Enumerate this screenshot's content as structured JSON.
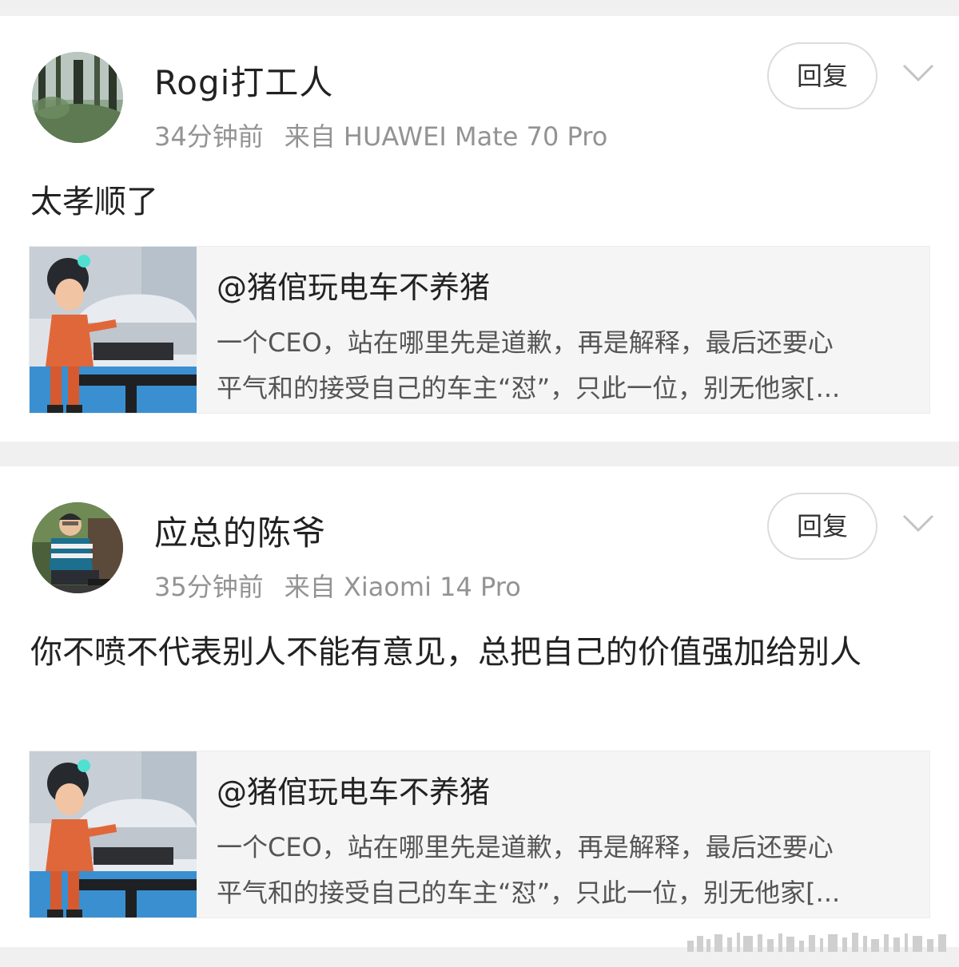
{
  "comments": [
    {
      "username": "Rogi打工人",
      "time": "34分钟前",
      "source": "来自 HUAWEI Mate 70 Pro",
      "reply_label": "回复",
      "text": "太孝顺了",
      "quote": {
        "title": "@猪倌玩电车不养猪",
        "line1": "一个CEO，站在哪里先是道歉，再是解释，最后还要心",
        "line2": "平气和的接受自己的车主“怼”，只此一位，别无他家[..."
      }
    },
    {
      "username": "应总的陈爷",
      "time": "35分钟前",
      "source": "来自 Xiaomi 14 Pro",
      "reply_label": "回复",
      "text": "你不喷不代表别人不能有意见，总把自己的价值强加给别人",
      "quote": {
        "title": "@猪倌玩电车不养猪",
        "line1": "一个CEO，站在哪里先是道歉，再是解释，最后还要心",
        "line2": "平气和的接受自己的车主“怼”，只此一位，别无他家[..."
      }
    }
  ],
  "colors": {
    "page_bg": "#f0f0f0",
    "card_bg": "#ffffff",
    "meta_text": "#939393",
    "quote_bg": "#f5f5f5"
  },
  "icons": [
    "forest-avatar",
    "person-avatar",
    "chevron-down-icon",
    "cartoon-mechanic-thumbnail"
  ]
}
